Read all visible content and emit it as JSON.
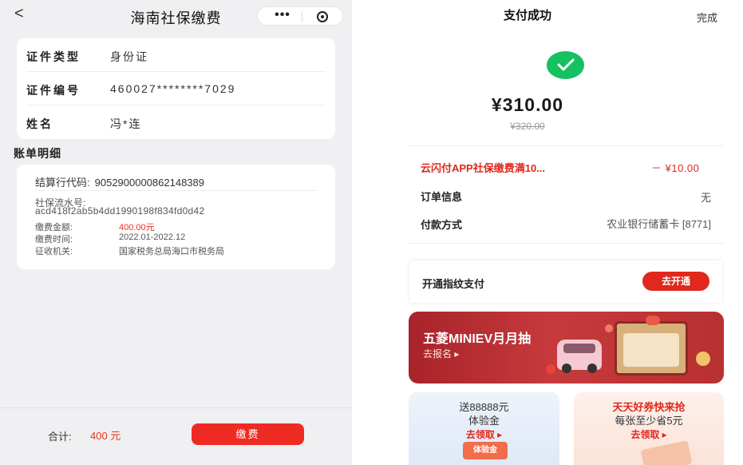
{
  "left": {
    "nav": {
      "back_icon": "<",
      "title": "海南社保缴费",
      "more_icon": "•••"
    },
    "identity": [
      {
        "label": "证件类型",
        "value": "身份证"
      },
      {
        "label": "证件编号",
        "value": "460027********7029"
      },
      {
        "label": "姓名",
        "value": "冯*连"
      }
    ],
    "section_title": "账单明细",
    "bill": {
      "code_label": "结算行代码:",
      "code_value": "9052900000862148389",
      "serial_label": "社保流水号:",
      "serial_value": "acd418f2ab5b4dd1990198f834fd0d42",
      "fields": [
        {
          "label": "缴费金额:",
          "value": "400.00元"
        },
        {
          "label": "缴费时间:",
          "value": "2022.01-2022.12"
        },
        {
          "label": "征收机关:",
          "value": "国家税务总局海口市税务局"
        }
      ]
    },
    "footer": {
      "total_label": "合计:",
      "total_value": "400 元",
      "pay_button": "缴费"
    }
  },
  "right": {
    "title": "支付成功",
    "done": "完成",
    "amount": "¥310.00",
    "original": "¥320.00",
    "promo_label": "云闪付APP社保缴费满10...",
    "promo_value": "－ ¥10.00",
    "order_label": "订单信息",
    "order_value": "无",
    "payment_label": "付款方式",
    "payment_value": "农业银行储蓄卡 [8771]",
    "fingerprint_label": "开通指纹支付",
    "fingerprint_button": "去开通",
    "banner": {
      "title": "五菱MINIEV月月抽",
      "subtitle": "去报名 ▸"
    },
    "tile_left": {
      "line1": "送88888元",
      "line2": "体验金",
      "link": "去领取 ▸",
      "coupon": "体验金"
    },
    "tile_right": {
      "line1": "天天好券快来抢",
      "line2": "每张至少省5元",
      "link": "去领取 ▸"
    },
    "colors": {
      "success": "#15c160",
      "accent_red": "#e0281d"
    }
  }
}
